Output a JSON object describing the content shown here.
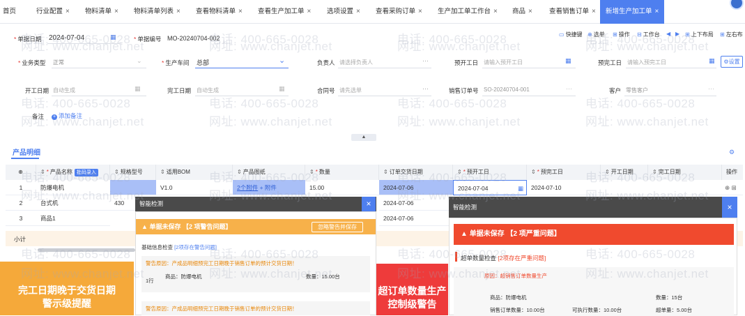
{
  "tabs": [
    {
      "label": "首页",
      "closable": false
    },
    {
      "label": "行业配置",
      "closable": true
    },
    {
      "label": "物料清单",
      "closable": true
    },
    {
      "label": "物料清单列表",
      "closable": true
    },
    {
      "label": "查看物料清单",
      "closable": true
    },
    {
      "label": "查看生产加工单",
      "closable": true
    },
    {
      "label": "选项设置",
      "closable": true
    },
    {
      "label": "查看采购订单",
      "closable": true
    },
    {
      "label": "生产加工单工作台",
      "closable": true
    },
    {
      "label": "商品",
      "closable": true
    },
    {
      "label": "查看销售订单",
      "closable": true
    },
    {
      "label": "新增生产加工单",
      "closable": true,
      "active": true
    }
  ],
  "close_glyph": "×",
  "watermark": {
    "phone": "电话: 400-665-0028",
    "site": "网址: www.chanjet.net"
  },
  "header": {
    "date_label": "单据日期",
    "date_value": "2024-07-04",
    "number_label": "单据编号",
    "number_value": "MO-20240704-002"
  },
  "toolbar": {
    "shortcut": "快捷键",
    "select": "选单",
    "operate": "操作",
    "workbench": "工作台",
    "layout_ud": "上下布局",
    "layout_lr": "左右布"
  },
  "form": {
    "business_type_label": "业务类型",
    "business_type_value": "正常",
    "workshop_label": "生产车间",
    "workshop_value": "总部",
    "owner_label": "负责人",
    "owner_placeholder": "请选择负责人",
    "plan_start_label": "预开工日",
    "plan_start_placeholder": "请输入预开工日",
    "plan_finish_label": "预完工日",
    "plan_finish_placeholder": "请输入预完工日",
    "settings": "设置",
    "start_label": "开工日期",
    "start_placeholder": "自动生成",
    "finish_label": "完工日期",
    "finish_placeholder": "自动生成",
    "contract_label": "合同号",
    "contract_placeholder": "请先选单",
    "sales_order_label": "销售订单号",
    "sales_order_value": "SO-20240704-001",
    "customer_label": "客户",
    "customer_value": "零售客户",
    "remark_label": "备注",
    "add_remark": "添加备注"
  },
  "section_title": "产品明细",
  "table": {
    "headers": [
      "产品名称",
      "批码录入",
      "规格型号",
      "适用BOM",
      "产品图纸",
      "数量",
      "订单交货日期",
      "预开工日",
      "预完工日",
      "开工日期",
      "完工日期",
      "操作"
    ],
    "rows": [
      {
        "no": "1",
        "name": "防爆电机",
        "spec": "",
        "bom": "V1.0",
        "drawing": "2个附件",
        "attach": "+ 附件",
        "qty": "15.00",
        "delivery": "2024-07-06",
        "plan_start": "2024-07-04",
        "plan_finish": "2024-07-10"
      },
      {
        "no": "2",
        "name": "台式机",
        "spec": "430",
        "bom": "",
        "drawing": "",
        "attach": "",
        "qty": "",
        "delivery": "2024-07-06",
        "plan_start": "",
        "plan_finish": ""
      },
      {
        "no": "3",
        "name": "商品1",
        "spec": "",
        "bom": "",
        "drawing": "",
        "attach": "",
        "qty": "",
        "delivery": "2024-07-06",
        "plan_start": "",
        "plan_finish": ""
      }
    ],
    "subtotal": "小计"
  },
  "dialog_left": {
    "title": "智能检测",
    "warning": "单据未保存 【2 项警告问题】",
    "ignore_button": "忽略警告并保存",
    "basic_check": "基础信息检查",
    "basic_count_pre": "[2项存在警告问题]",
    "reason1": "警告原因：产成品明细预完工日期晚于销售订单的预计交货日期！",
    "row_label": "1行",
    "product": "商品：防爆电机",
    "qty": "数量：15.00台",
    "reason2": "警告原因：产成品明细预完工日期晚于销售订单的预计交货日期！"
  },
  "dialog_right": {
    "title": "智能检测",
    "warning": "单据未保存 【2 项严重问题】",
    "check": "超单数量检查",
    "check_count": "[2项存在严重问题]",
    "reason": "原因：超销售订单数量生产",
    "product": "商品：防爆电机",
    "qty": "数量：15台",
    "so_qty": "销售订单数量：10.00台",
    "exec_qty": "可执行数量：10.00台",
    "over_qty": "超单量：5.00台"
  },
  "badges": {
    "left_line1": "完工日期晚于交货日期",
    "left_line2": "警示级提醒",
    "right_line1": "超订单数量生产",
    "right_line2": "控制级警告"
  },
  "colors": {
    "accent": "#4e7fef",
    "warning": "#f7b14a",
    "error": "#f04a2e",
    "badge_left": "#f5a93a",
    "badge_right": "#ee3b3b"
  }
}
